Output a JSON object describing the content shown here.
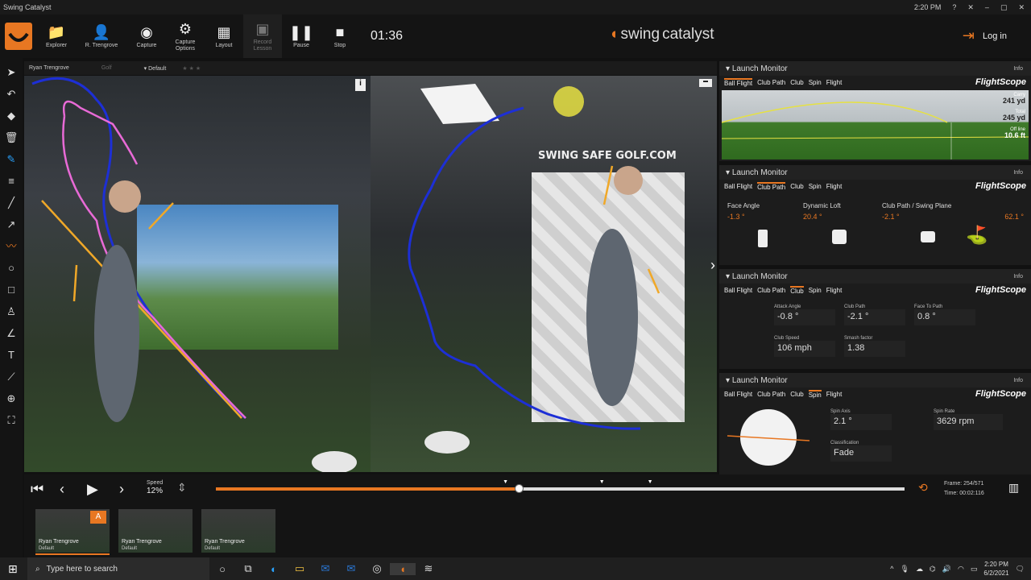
{
  "window": {
    "title": "Swing Catalyst",
    "time": "2:20 PM",
    "controls": [
      "?",
      "✕",
      "–",
      "▢",
      "✕"
    ]
  },
  "toolbar": {
    "buttons": [
      {
        "label": "Explorer",
        "icon": "folder-icon"
      },
      {
        "label": "R. Trengrove",
        "icon": "user-icon"
      },
      {
        "label": "Capture",
        "icon": "capture-icon"
      },
      {
        "label": "Capture\nOptions",
        "icon": "gear-icon"
      },
      {
        "label": "Layout",
        "icon": "grid-icon"
      },
      {
        "label": "Record\nLesson",
        "icon": "record-icon"
      },
      {
        "label": "Pause",
        "icon": "pause-icon"
      },
      {
        "label": "Stop",
        "icon": "stop-icon"
      }
    ],
    "timer": "01:36",
    "brand_a": "swing",
    "brand_b": "catalyst",
    "login": "Log in"
  },
  "video": {
    "player": "Ryan Trengrove",
    "sport": "Golf",
    "profile": "Default",
    "stars": "★★★",
    "banner": "SWING SAFE GOLF.COM"
  },
  "panels": [
    {
      "title": "Launch Monitor",
      "info": "Info",
      "tabs": [
        "Ball Flight",
        "Club Path",
        "Club",
        "Spin",
        "Flight"
      ],
      "active_tab": 0,
      "brand": "FlightScope",
      "ball_flight": {
        "carry_label": "Carry",
        "carry": "241 yd",
        "total_label": "Total",
        "total": "245 yd",
        "offline_label": "Off line",
        "offline": "10.6 ft"
      }
    },
    {
      "title": "Launch Monitor",
      "info": "Info",
      "tabs": [
        "Ball Flight",
        "Club Path",
        "Club",
        "Spin",
        "Flight"
      ],
      "active_tab": 1,
      "brand": "FlightScope",
      "metrics": [
        {
          "label": "Face Angle",
          "value": "-1.3 °"
        },
        {
          "label": "Dynamic Loft",
          "value": "20.4 °"
        },
        {
          "label": "Club Path / Swing Plane",
          "value": "-2.1 °",
          "value2": "62.1 °"
        }
      ]
    },
    {
      "title": "Launch Monitor",
      "info": "Info",
      "tabs": [
        "Ball Flight",
        "Club Path",
        "Club",
        "Spin",
        "Flight"
      ],
      "active_tab": 2,
      "brand": "FlightScope",
      "fields": [
        {
          "label": "Attack Angle",
          "value": "-0.8 °"
        },
        {
          "label": "Club Path",
          "value": "-2.1 °"
        },
        {
          "label": "Face To Path",
          "value": "0.8 °"
        },
        {
          "label": "Club Speed",
          "value": "106 mph"
        },
        {
          "label": "Smash factor",
          "value": "1.38"
        }
      ]
    },
    {
      "title": "Launch Monitor",
      "info": "Info",
      "tabs": [
        "Ball Flight",
        "Club Path",
        "Club",
        "Spin",
        "Flight"
      ],
      "active_tab": 3,
      "brand": "FlightScope",
      "fields": [
        {
          "label": "Spin Axis",
          "value": "2.1 °"
        },
        {
          "label": "Spin Rate",
          "value": "3629 rpm"
        },
        {
          "label": "Classification",
          "value": "Fade"
        }
      ]
    }
  ],
  "playback": {
    "speed_label": "Speed",
    "speed": "12%",
    "progress": 0.44,
    "markers": [
      0.42,
      0.56,
      0.63
    ],
    "frame_label": "Frame:",
    "frame": "254/571",
    "time_label": "Time:",
    "time": "00:02:116"
  },
  "thumbnails": [
    {
      "name": "Ryan Trengrove",
      "profile": "Default",
      "badge": "A"
    },
    {
      "name": "Ryan Trengrove",
      "profile": "Default"
    },
    {
      "name": "Ryan Trengrove",
      "profile": "Default"
    }
  ],
  "taskbar": {
    "search_placeholder": "Type here to search",
    "clock_time": "2:20 PM",
    "clock_date": "6/2/2021"
  }
}
